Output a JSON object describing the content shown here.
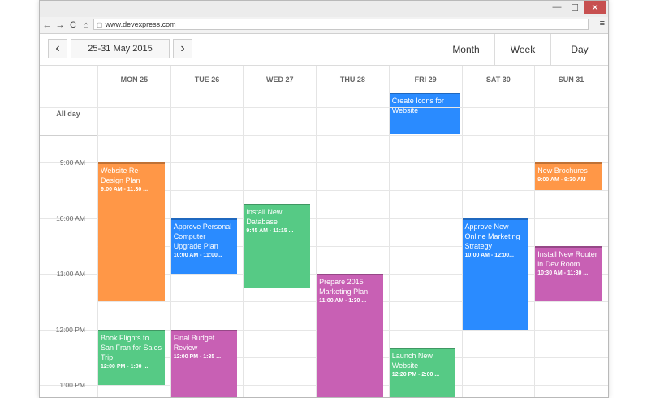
{
  "browser": {
    "url": "www.devexpress.com",
    "min_glyph": "—",
    "max_glyph": "☐",
    "close_glyph": "✕",
    "back_glyph": "←",
    "forward_glyph": "→",
    "reload_glyph": "C",
    "home_glyph": "⌂",
    "menu_glyph": "≡"
  },
  "toolbar": {
    "prev_glyph": "‹",
    "next_glyph": "›",
    "date_range": "25-31 May 2015",
    "views": [
      "Month",
      "Week",
      "Day"
    ],
    "active_view": "Week"
  },
  "days": [
    "MON 25",
    "TUE 26",
    "WED 27",
    "THU 28",
    "FRI 29",
    "SAT 30",
    "SUN 31"
  ],
  "allday_label": "All day",
  "times": [
    "9:00 AM",
    "10:00 AM",
    "11:00 AM",
    "12:00 PM",
    "1:00 PM"
  ],
  "colors": {
    "orange": "#ff9747",
    "blue": "#2a8bff",
    "green": "#56ca85",
    "purple": "#c860b4"
  },
  "allday_events": [
    {
      "title": "Create Icons for Website",
      "day": 4,
      "color": "blue"
    }
  ],
  "events": [
    {
      "title": "Website Re-Design Plan",
      "time": "9:00 AM - 11:30 ...",
      "day": 0,
      "start": 9.0,
      "end": 11.5,
      "color": "orange"
    },
    {
      "title": "Book Flights to San Fran for Sales Trip",
      "time": "12:00 PM - 1:00 ...",
      "day": 0,
      "start": 12.0,
      "end": 13.0,
      "color": "green"
    },
    {
      "title": "Approve Personal Computer Upgrade Plan",
      "time": "10:00 AM - 11:00...",
      "day": 1,
      "start": 10.0,
      "end": 11.0,
      "color": "blue"
    },
    {
      "title": "Final Budget Review",
      "time": "12:00 PM - 1:35 ...",
      "day": 1,
      "start": 12.0,
      "end": 13.6,
      "color": "purple"
    },
    {
      "title": "Install New Database",
      "time": "9:45 AM - 11:15 ...",
      "day": 2,
      "start": 9.75,
      "end": 11.25,
      "color": "green"
    },
    {
      "title": "Prepare 2015 Marketing Plan",
      "time": "11:00 AM - 1:30 ...",
      "day": 3,
      "start": 11.0,
      "end": 13.5,
      "color": "purple"
    },
    {
      "title": "Launch New Website",
      "time": "12:20 PM - 2:00 ...",
      "day": 4,
      "start": 12.333,
      "end": 13.6,
      "color": "green"
    },
    {
      "title": "Approve New Online Marketing Strategy",
      "time": "10:00 AM - 12:00...",
      "day": 5,
      "start": 10.0,
      "end": 12.0,
      "color": "blue"
    },
    {
      "title": "New Brochures",
      "time": "9:00 AM - 9:30 AM",
      "day": 6,
      "start": 9.0,
      "end": 9.5,
      "color": "orange"
    },
    {
      "title": "Install New Router in Dev Room",
      "time": "10:30 AM - 11:30 ...",
      "day": 6,
      "start": 10.5,
      "end": 11.5,
      "color": "purple"
    }
  ]
}
